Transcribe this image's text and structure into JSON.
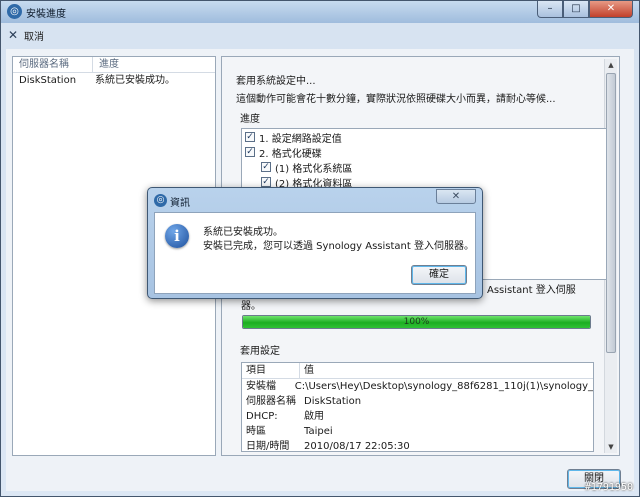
{
  "window": {
    "title": "安裝進度",
    "buttons": {
      "minimize": "–",
      "maximize": "□",
      "close": "✕"
    }
  },
  "toolbar": {
    "cancel_label": "取消"
  },
  "server_list": {
    "headers": [
      "伺服器名稱",
      "進度"
    ],
    "rows": [
      {
        "name": "DiskStation",
        "status": "系統已安裝成功。"
      }
    ]
  },
  "detail": {
    "status_line": "套用系統設定中...",
    "note_line": "這個動作可能會花十數分鐘，實際狀況依照硬碟大小而異，請耐心等候...",
    "progress_label": "進度",
    "steps": [
      {
        "label": "1. 設定網路設定值",
        "checked": true,
        "indent": 0
      },
      {
        "label": "2. 格式化硬碟",
        "checked": true,
        "indent": 0
      },
      {
        "label": "(1) 格式化系統區",
        "checked": true,
        "indent": 1
      },
      {
        "label": "(2) 格式化資料區",
        "checked": true,
        "indent": 1
      }
    ],
    "progress_tail_a": "Assistant 登入伺服",
    "progress_tail_b": "器。",
    "progress_percent": 100,
    "progress_text": "100%",
    "config_label": "套用設定",
    "config_headers": [
      "項目",
      "值"
    ],
    "config_rows": [
      {
        "key": "安裝檔",
        "value": "C:\\Users\\Hey\\Desktop\\synology_88f6281_110j(1)\\synology_"
      },
      {
        "key": "伺服器名稱",
        "value": "DiskStation"
      },
      {
        "key": "DHCP:",
        "value": "啟用"
      },
      {
        "key": "時區",
        "value": "Taipei"
      },
      {
        "key": "日期/時間",
        "value": "2010/08/17 22:05:30"
      }
    ],
    "close_button": "關閉"
  },
  "dialog": {
    "title": "資訊",
    "close": "✕",
    "line1": "系統已安裝成功。",
    "line2": "安裝已完成，您可以透過 Synology Assistant 登入伺服器。",
    "ok_button": "確定"
  },
  "watermark": "#1791950",
  "colors": {
    "progress_green": "#1cae22",
    "accent_blue": "#2f6aa8"
  }
}
